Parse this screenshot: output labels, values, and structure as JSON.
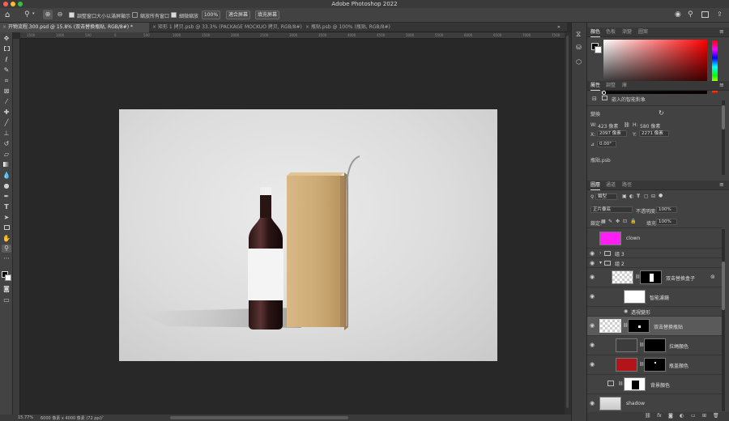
{
  "app": {
    "title": "Adobe Photoshop 2022",
    "traffic_colors": [
      "#fe5f57",
      "#febc2e",
      "#28c840"
    ]
  },
  "options_bar": {
    "resize_windows_label": "調整窗口大小以滿屏顯示",
    "zoom_all_label": "縮放所有窗口",
    "scrubby_zoom_label": "細微縮放",
    "zoom_value": "100%",
    "fit_screen_label": "適合屏幕",
    "fill_screen_label": "填充屏幕"
  },
  "tabs": [
    {
      "label": "开物流程.300.psd @ 15.8% (双击替换瓶贴, RGB/8#) *",
      "active": true
    },
    {
      "label": "矩形 1 拷贝.psb @ 33.3% (PACKAGE MOCKUO 拷贝, RGB/8#)",
      "active": false
    },
    {
      "label": "瓶贴.psb @ 100% (瓶贴, RGB/8#)",
      "active": false
    }
  ],
  "ruler_ticks": [
    "1500",
    "1000",
    "500",
    "0",
    "500",
    "1000",
    "1500",
    "2000",
    "2500",
    "3000",
    "3500",
    "4000",
    "4500",
    "5000",
    "5500",
    "6000",
    "6500",
    "7000",
    "7500"
  ],
  "status": {
    "zoom": "15.77%",
    "doc_info": "6000 像素 x 4000 像素 (72 ppi)"
  },
  "color_panel": {
    "tabs": [
      "顏色",
      "色板",
      "漸變",
      "圖案"
    ],
    "hue_base": "#ff0000"
  },
  "properties_panel": {
    "tabs": [
      "屬性",
      "調整",
      "庫"
    ],
    "object_type": "嵌入的智能對象",
    "transform_label": "變換",
    "w_label": "W:",
    "w_value": "423 像素",
    "h_label": "H:",
    "h_value": "580 像素",
    "x_label": "X:",
    "x_value": "2097 像素",
    "y_label": "Y:",
    "y_value": "2271 像素",
    "angle_value": "0.00°",
    "source_file": "瓶貼.psb"
  },
  "layers_panel": {
    "tabs": [
      "圖層",
      "通道",
      "路徑"
    ],
    "filter_kind": "類型",
    "blend_mode": "正片疊底",
    "opacity_label": "不透明度:",
    "opacity_value": "100%",
    "lock_label": "鎖定:",
    "fill_label": "填充:",
    "fill_value": "100%",
    "layers": [
      {
        "name": "clown",
        "eye": false,
        "thumb": "magenta"
      },
      {
        "name": "组 3",
        "eye": true,
        "type": "group"
      },
      {
        "name": "组 2",
        "eye": true,
        "type": "group"
      },
      {
        "name": "双击替换盒子",
        "eye": true,
        "thumb": "checker"
      },
      {
        "name": "智能濾鏡",
        "eye": true,
        "thumb": "white"
      },
      {
        "name": "透視變形",
        "eye": true,
        "type": "effect"
      },
      {
        "name": "双击替换瓶贴",
        "eye": true,
        "thumb": "checker",
        "selected": true
      },
      {
        "name": "拉绳顏色",
        "eye": true,
        "thumb": "dark"
      },
      {
        "name": "瓶盖顏色",
        "eye": true,
        "thumb": "red"
      },
      {
        "name": "背景顏色",
        "eye": false,
        "thumb": "bw"
      },
      {
        "name": "shadow",
        "eye": true,
        "thumb": "light"
      }
    ]
  }
}
